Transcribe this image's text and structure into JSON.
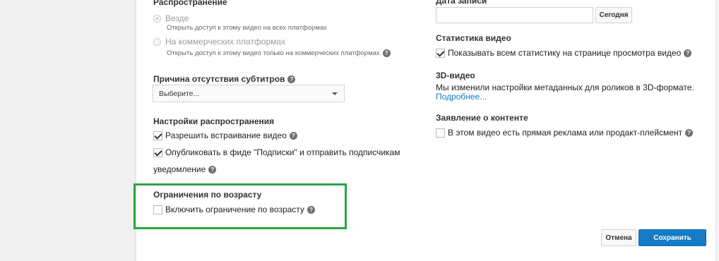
{
  "distribution": {
    "title": "Распространение",
    "options": [
      {
        "label": "Везде",
        "hint": "Открыть доступ к этому видео на всех платформах",
        "selected": true
      },
      {
        "label": "На коммерческих платформах",
        "hint": "Открыть доступ к этому видео только на коммерческих платформах",
        "selected": false
      }
    ]
  },
  "subtitles": {
    "title": "Причина отсутствия субтитров",
    "select_value": "Выберите..."
  },
  "sharing": {
    "title": "Настройки распространения",
    "allow_embed": {
      "label": "Разрешить встраивание видео",
      "checked": true
    },
    "publish_feed": {
      "label": "Опубликовать в фиде \"Подписки\" и отправить подписчикам",
      "label_cont": "уведомление",
      "checked": true
    }
  },
  "age": {
    "title": "Ограничения по возрасту",
    "enable": {
      "label": "Включить ограничение по возрасту",
      "checked": false
    }
  },
  "record_date": {
    "title": "Дата записи",
    "value": "",
    "today_button": "Сегодня"
  },
  "stats": {
    "title": "Статистика видео",
    "show_stats": {
      "label": "Показывать всем статистику на странице просмотра видео",
      "checked": true
    }
  },
  "video3d": {
    "title": "3D-видео",
    "text": "Мы изменили настройки метаданных для роликов в 3D-формате.",
    "link": "Подробнее..."
  },
  "content_declaration": {
    "title": "Заявление о контенте",
    "paid_promo": {
      "label": "В этом видео есть прямая реклама или продакт-плейсмент",
      "checked": false
    }
  },
  "actions": {
    "cancel": "Отмена",
    "save": "Сохранить"
  },
  "help_glyph": "?",
  "colors": {
    "accent": "#167ac6",
    "highlight": "#2aa540"
  }
}
